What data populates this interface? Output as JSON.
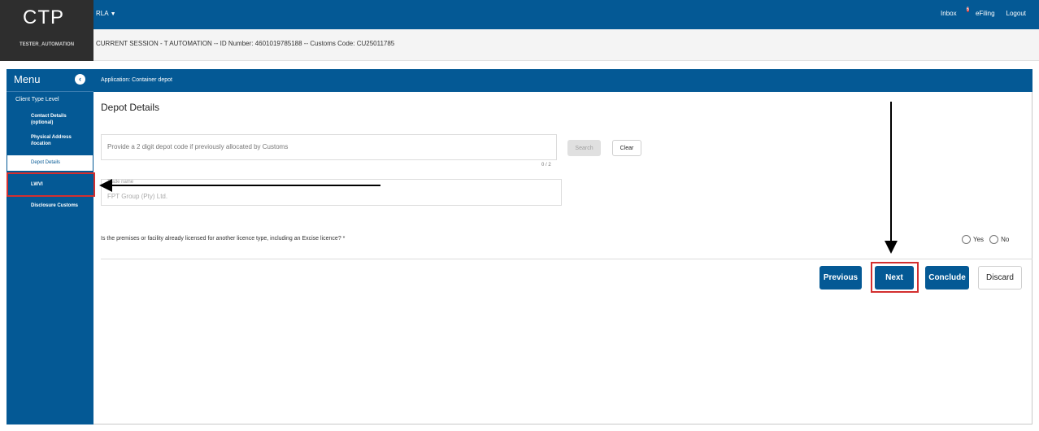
{
  "header": {
    "logo": "CTP",
    "username": "TESTER_AUTOMATION",
    "app_menu": "RLA",
    "inbox_label": "Inbox",
    "inbox_count": "6",
    "efiling_label": "eFiling",
    "logout_label": "Logout"
  },
  "session": {
    "text": "CURRENT SESSION - T AUTOMATION -- ID Number: 4601019785188 -- Customs Code: CU25011785"
  },
  "sidebar": {
    "title": "Menu",
    "level": "Client Type Level",
    "items": [
      {
        "label": "Contact Details (optional)"
      },
      {
        "label": "Physical Address /location"
      },
      {
        "label": "Depot Details"
      },
      {
        "label": "LWVI"
      },
      {
        "label": "Disclosure Customs"
      }
    ]
  },
  "content": {
    "application": "Application: Container depot",
    "section_title": "Depot Details",
    "depot_placeholder": "Provide a 2 digit depot code if previously allocated by Customs",
    "depot_counter": "0 / 2",
    "search_label": "Search",
    "clear_label": "Clear",
    "trade_name_label": "Trade name",
    "trade_name_value": "FPT Group (Pty) Ltd.",
    "question": "Is the premises or facility already licensed for another licence type, including an Excise licence? *",
    "yes_label": "Yes",
    "no_label": "No"
  },
  "actions": {
    "previous": "Previous",
    "next": "Next",
    "conclude": "Conclude",
    "discard": "Discard"
  },
  "annotations": {
    "highlight_color": "#d32f2f",
    "arrow_color": "#000000"
  }
}
